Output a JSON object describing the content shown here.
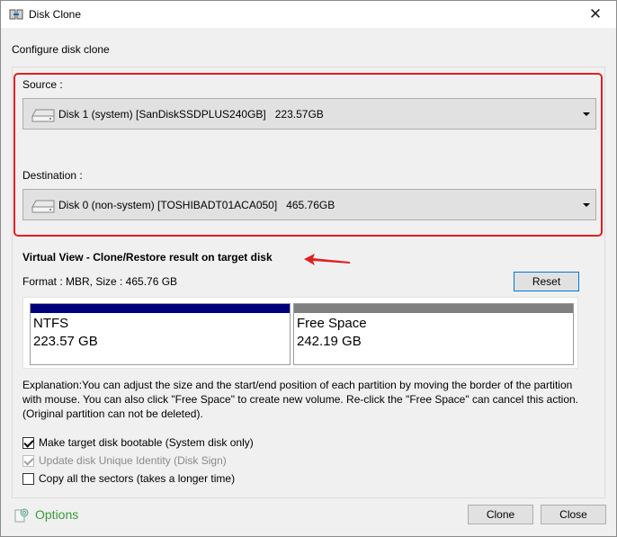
{
  "window": {
    "title": "Disk Clone",
    "close_glyph": "✕"
  },
  "header": {
    "configure_label": "Configure disk clone"
  },
  "source": {
    "label": "Source :",
    "disk": "Disk 1 (system) [SanDiskSSDPLUS240GB]   223.57GB",
    "icon": "hard-disk-icon"
  },
  "destination": {
    "label": "Destination :",
    "disk": "Disk 0 (non-system) [TOSHIBADT01ACA050]   465.76GB",
    "icon": "hard-disk-icon"
  },
  "virtual_view": {
    "title": "Virtual View - Clone/Restore result on target disk",
    "format_text": "Format : MBR,  Size : 465.76 GB",
    "reset_label": "Reset",
    "partitions": [
      {
        "name": "NTFS",
        "size": "223.57 GB",
        "color": "#00007f"
      },
      {
        "name": "Free Space",
        "size": "242.19 GB",
        "color": "#808080"
      }
    ]
  },
  "explanation": "Explanation:You can adjust the size and the start/end position of each partition by moving the border of the partition with mouse. You can also click \"Free Space\" to create new volume. Re-click the \"Free Space\" can cancel this action. (Original partition can not be deleted).",
  "options_checks": [
    {
      "label": "Make target disk bootable (System disk only)",
      "checked": true,
      "disabled": false
    },
    {
      "label": "Update disk Unique Identity (Disk Sign)",
      "checked": true,
      "disabled": true
    },
    {
      "label": "Copy all the sectors (takes a longer time)",
      "checked": false,
      "disabled": false
    }
  ],
  "footer": {
    "options_label": "Options",
    "clone_label": "Clone",
    "close_label": "Close"
  },
  "colors": {
    "highlight_red": "#e02020",
    "options_green": "#3a9a3a",
    "ntfs_bar": "#00007f",
    "free_bar": "#808080"
  }
}
